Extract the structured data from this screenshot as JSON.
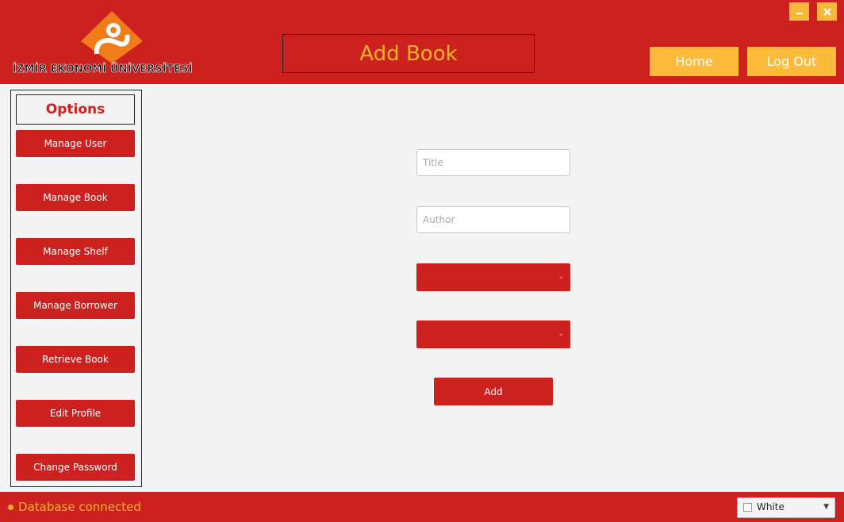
{
  "header": {
    "logo_text": "İZMİR EKONOMİ ÜNİVERSİTESİ",
    "page_title": "Add Book",
    "home_label": "Home",
    "logout_label": "Log Out"
  },
  "window": {
    "minimize_icon": "minimize-icon",
    "close_icon": "close-icon"
  },
  "sidebar": {
    "title": "Options",
    "items": [
      {
        "label": "Manage User"
      },
      {
        "label": "Manage Book"
      },
      {
        "label": "Manage Shelf"
      },
      {
        "label": "Manage Borrower"
      },
      {
        "label": "Retrieve Book"
      },
      {
        "label": "Edit Profile"
      },
      {
        "label": "Change Password"
      }
    ]
  },
  "form": {
    "title_placeholder": "Title",
    "title_value": "",
    "author_placeholder": "Author",
    "author_value": "",
    "combo1_value": "",
    "combo2_value": "",
    "add_label": "Add"
  },
  "status": {
    "text": "Database connected",
    "theme_value": "White"
  },
  "colors": {
    "primary_red": "#cc211e",
    "accent_yellow": "#f5b428",
    "button_yellow": "#fdbb3b"
  }
}
